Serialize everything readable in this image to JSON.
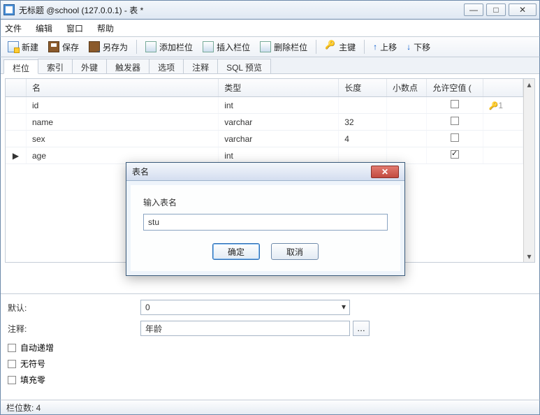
{
  "window": {
    "title": "无标题 @school (127.0.0.1) - 表 *"
  },
  "winbtns": {
    "min": "—",
    "max": "□",
    "close": "✕"
  },
  "menu": {
    "file": "文件",
    "edit": "编辑",
    "window": "窗口",
    "help": "帮助"
  },
  "toolbar": {
    "new": "新建",
    "save": "保存",
    "saveas": "另存为",
    "addcol": "添加栏位",
    "insertcol": "插入栏位",
    "delcol": "删除栏位",
    "pkey": "主键",
    "moveup": "上移",
    "movedown": "下移",
    "up_sym": "↑",
    "down_sym": "↓"
  },
  "tabs": {
    "cols": "栏位",
    "index": "索引",
    "fkey": "外键",
    "trigger": "触发器",
    "option": "选项",
    "comment": "注释",
    "sql": "SQL 预览"
  },
  "grid": {
    "hdr": {
      "name": "名",
      "type": "类型",
      "len": "长度",
      "dec": "小数点",
      "null": "允许空值 ("
    },
    "rows": [
      {
        "ind": "",
        "name": "id",
        "type": "int",
        "len": "",
        "dec": "",
        "null": false,
        "key": "1"
      },
      {
        "ind": "",
        "name": "name",
        "type": "varchar",
        "len": "32",
        "dec": "",
        "null": false,
        "key": ""
      },
      {
        "ind": "",
        "name": "sex",
        "type": "varchar",
        "len": "4",
        "dec": "",
        "null": false,
        "key": ""
      },
      {
        "ind": "▶",
        "name": "age",
        "type": "int",
        "len": "",
        "dec": "",
        "null": true,
        "key": ""
      }
    ]
  },
  "props": {
    "default_lbl": "默认:",
    "default_val": "0",
    "comment_lbl": "注释:",
    "comment_val": "年龄",
    "ell": "…",
    "autoinc": "自动递增",
    "unsigned": "无符号",
    "zerofill": "填充零"
  },
  "status": {
    "text": "栏位数: 4"
  },
  "dialog": {
    "title": "表名",
    "label": "输入表名",
    "value": "stu",
    "ok": "确定",
    "cancel": "取消",
    "close": "✕"
  }
}
